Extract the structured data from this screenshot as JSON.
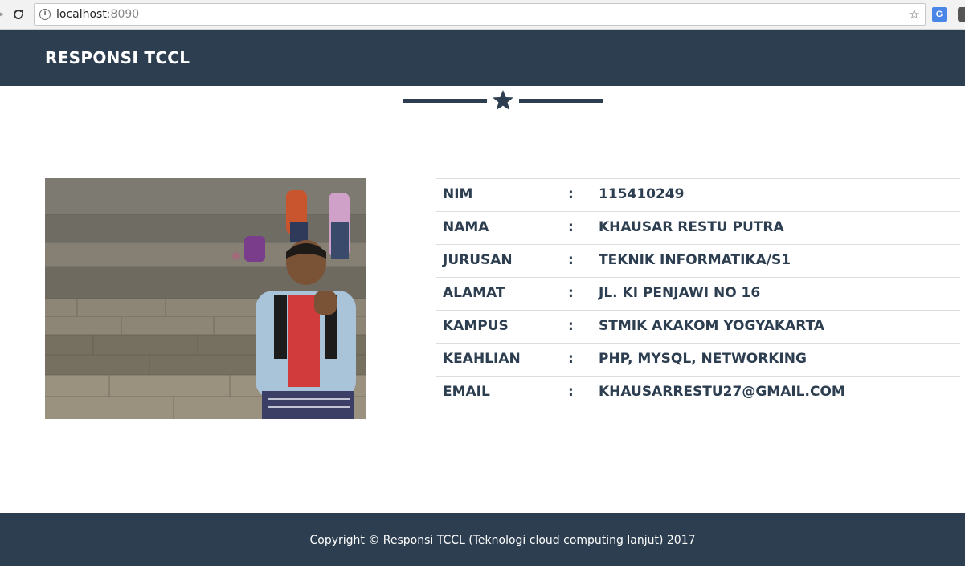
{
  "browser": {
    "url_host": "localhost",
    "url_port": ":8090"
  },
  "navbar": {
    "brand": "RESPONSI TCCL"
  },
  "profile": {
    "rows": [
      {
        "label": "NIM",
        "sep": ":",
        "value": "115410249"
      },
      {
        "label": "NAMA",
        "sep": ":",
        "value": "KHAUSAR RESTU PUTRA"
      },
      {
        "label": "JURUSAN",
        "sep": ":",
        "value": "TEKNIK INFORMATIKA/S1"
      },
      {
        "label": "ALAMAT",
        "sep": ":",
        "value": "JL. KI PENJAWI NO 16"
      },
      {
        "label": "KAMPUS",
        "sep": ":",
        "value": "STMIK AKAKOM YOGYAKARTA"
      },
      {
        "label": "KEAHLIAN",
        "sep": ":",
        "value": "PHP, MYSQL, NETWORKING"
      },
      {
        "label": "EMAIL",
        "sep": ":",
        "value": "KHAUSARRESTU27@GMAIL.COM"
      }
    ]
  },
  "footer": {
    "copyright": "Copyright © Responsi TCCL (Teknologi cloud computing lanjut) 2017"
  },
  "colors": {
    "primary": "#2c3e50",
    "footer_text": "#ffffff"
  }
}
